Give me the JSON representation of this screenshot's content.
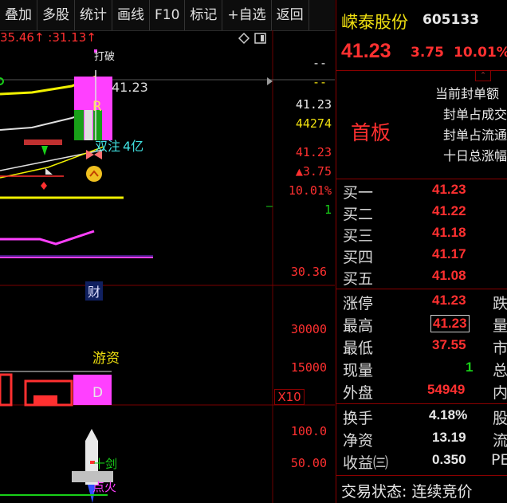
{
  "toolbar": {
    "items": [
      "叠加",
      "多股",
      "统计",
      "画线",
      "F10",
      "标记",
      "+自选",
      "返回"
    ]
  },
  "chart": {
    "top_left_readout": "35.46↑ :31.13↑",
    "label_dakai": "打破",
    "label_r": "R",
    "price_marker": "41.23",
    "label_shuangjin": "双注",
    "label_4yi": "4亿",
    "label_cai": "财",
    "label_youzi": "游资",
    "label_d": "D",
    "label_shijian": "十剑",
    "label_dianhuo": "点火",
    "axis": {
      "dash1": "--",
      "dash2": "--",
      "v1": "41.23",
      "v2": "44274",
      "v3": "41.23",
      "v4": "▲3.75",
      "v5": "10.01%",
      "v6": "1",
      "v7": "30.36",
      "v8": "30000",
      "v9": "15000",
      "v10": "X10",
      "v11": "100.0",
      "v12": "50.00"
    }
  },
  "stock": {
    "name": "嵘泰股份",
    "code": "605133",
    "price": "41.23",
    "change": "3.75",
    "pct": "10.01%",
    "board_label": "首板",
    "seal_lines": [
      "当前封单额",
      "封单占成交",
      "封单占流通",
      "十日总涨幅"
    ]
  },
  "book": [
    {
      "label": "买一",
      "value": "41.23"
    },
    {
      "label": "买二",
      "value": "41.22"
    },
    {
      "label": "买三",
      "value": "41.18"
    },
    {
      "label": "买四",
      "value": "41.17"
    },
    {
      "label": "买五",
      "value": "41.08"
    }
  ],
  "stats": [
    {
      "label": "涨停",
      "value": "41.23",
      "right": "跌"
    },
    {
      "label": "最高",
      "value": "41.23",
      "right": "量"
    },
    {
      "label": "最低",
      "value": "37.55",
      "right": "市"
    },
    {
      "label": "现量",
      "value": "1",
      "right": "总"
    },
    {
      "label": "外盘",
      "value": "54949",
      "right": "内"
    }
  ],
  "fin": [
    {
      "label": "换手",
      "value": "4.18%",
      "right": "股"
    },
    {
      "label": "净资",
      "value": "13.19",
      "right": "流"
    },
    {
      "label": "收益㈢",
      "value": "0.350",
      "right": "PE"
    }
  ],
  "status": "交易状态: 连续竞价"
}
